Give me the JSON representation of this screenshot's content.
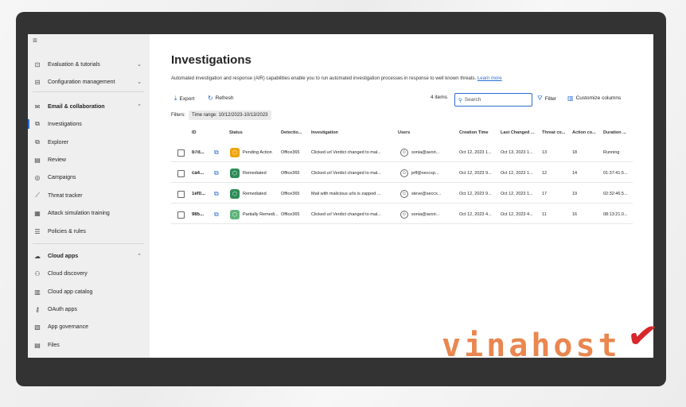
{
  "sidebar": {
    "items": [
      {
        "label": "Evaluation & tutorials",
        "icon": "evaluation-icon",
        "glyph": "⊡",
        "chevron": "⌄"
      },
      {
        "label": "Configuration management",
        "icon": "config-icon",
        "glyph": "⊟",
        "chevron": "⌄"
      },
      {
        "label": "Email & collaboration",
        "icon": "mail-icon",
        "glyph": "✉",
        "chevron": "⌃"
      },
      {
        "label": "Investigations",
        "icon": "investigations-icon",
        "glyph": "⧉"
      },
      {
        "label": "Explorer",
        "icon": "explorer-icon",
        "glyph": "⧉"
      },
      {
        "label": "Review",
        "icon": "review-icon",
        "glyph": "▤"
      },
      {
        "label": "Campaigns",
        "icon": "campaigns-icon",
        "glyph": "◎"
      },
      {
        "label": "Threat tracker",
        "icon": "threat-tracker-icon",
        "glyph": "⟋"
      },
      {
        "label": "Attack simulation training",
        "icon": "attack-sim-icon",
        "glyph": "▦"
      },
      {
        "label": "Policies & rules",
        "icon": "policies-icon",
        "glyph": "☰"
      },
      {
        "label": "Cloud apps",
        "icon": "cloud-icon",
        "glyph": "☁",
        "chevron": "⌃"
      },
      {
        "label": "Cloud discovery",
        "icon": "cloud-discovery-icon",
        "glyph": "⚇"
      },
      {
        "label": "Cloud app catalog",
        "icon": "catalog-icon",
        "glyph": "▥"
      },
      {
        "label": "OAuth apps",
        "icon": "oauth-icon",
        "glyph": "⚷"
      },
      {
        "label": "App governance",
        "icon": "governance-icon",
        "glyph": "▧"
      },
      {
        "label": "Files",
        "icon": "files-icon",
        "glyph": "▤"
      }
    ]
  },
  "page": {
    "title": "Investigations",
    "description": "Automated investigation and response (AIR) capabilities enable you to run automated investigation processes in response to well known threats.",
    "learn_more": "Learn more"
  },
  "toolbar": {
    "export": "Export",
    "refresh": "Refresh",
    "count": "4 items",
    "search_placeholder": "Search",
    "filter": "Filter",
    "customize": "Customize columns"
  },
  "filters": {
    "label": "Filters:",
    "time_range": "Time range: 10/12/2023-10/13/2023"
  },
  "table": {
    "headers": [
      "ID",
      "Status",
      "Detectio...",
      "Investigation",
      "Users",
      "Creation Time",
      "Last Changed ...",
      "Threat co...",
      "Action co...",
      "Duration ..."
    ],
    "rows": [
      {
        "id": "b7d...",
        "status": "Pending Action",
        "status_color": "#f0a30a",
        "detection": "Office365",
        "investigation": "Clicked url Verdict changed to mal...",
        "user": "sonia@avori...",
        "created": "Oct 12, 2023 1...",
        "changed": "Oct 13, 2023 1...",
        "threat": "13",
        "action": "18",
        "duration": "Running"
      },
      {
        "id": "ca4...",
        "status": "Remediated",
        "status_color": "#2e8b57",
        "detection": "Office365",
        "investigation": "Clicked url Verdict changed to mal...",
        "user": "jeff@seccxp...",
        "created": "Oct 12, 2023 9...",
        "changed": "Oct 12, 2023 1...",
        "threat": "12",
        "action": "14",
        "duration": "01:37:41.5..."
      },
      {
        "id": "1ef0...",
        "status": "Remediated",
        "status_color": "#2e8b57",
        "detection": "Office365",
        "investigation": "Mail with malicious urls is zapped ...",
        "user": "steve@seccx...",
        "created": "Oct 12, 2023 9...",
        "changed": "Oct 12, 2023 1...",
        "threat": "17",
        "action": "19",
        "duration": "02:32:46.5..."
      },
      {
        "id": "985...",
        "status": "Partially Remedi...",
        "status_color": "#5fb37a",
        "detection": "Office365",
        "investigation": "Clicked url Verdict changed to mal...",
        "user": "sonia@avori...",
        "created": "Oct 12, 2023 4...",
        "changed": "Oct 12, 2023 4...",
        "threat": "11",
        "action": "16",
        "duration": "08:13:21.0..."
      }
    ]
  },
  "watermark": {
    "text": "vinahost"
  }
}
